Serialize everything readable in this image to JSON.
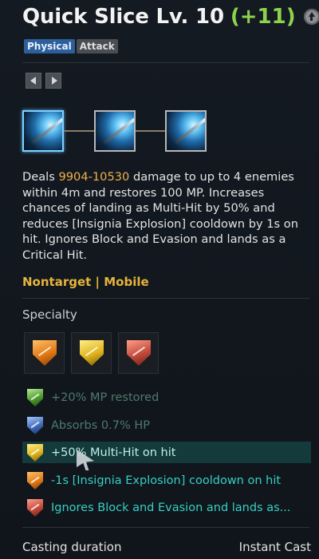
{
  "skill": {
    "name": "Quick Slice Lv. 10",
    "bonus": "(+11)",
    "tags": [
      "Physical",
      "Attack"
    ],
    "description": {
      "prefix": "Deals ",
      "damage": "9904-10530",
      "rest": " damage to up to 4 enemies within 4m and restores 100 MP. Increases chances of landing as Multi-Hit by 50% and reduces [Insignia Explosion] cooldown by 1s on hit. Ignores Block and Evasion and lands as a Critical Hit."
    },
    "properties": "Nontarget | Mobile"
  },
  "specialty": {
    "title": "Specialty",
    "slots": [
      {
        "icon": "specialty-orange-shield-icon",
        "color": "#e07a14"
      },
      {
        "icon": "specialty-yellow-shield-icon",
        "color": "#e0b41c"
      },
      {
        "icon": "specialty-red-shield-icon",
        "color": "#c24a3b"
      }
    ],
    "effects": [
      {
        "label": "+20% MP restored",
        "state": "inactive",
        "icon": "green-shield-icon",
        "color": "#4d9a2a"
      },
      {
        "label": "Absorbs 0.7% HP",
        "state": "inactive",
        "icon": "blue-shield-icon",
        "color": "#3f6ab8"
      },
      {
        "label": "+50% Multi-Hit on hit",
        "state": "hovered",
        "icon": "yellow-shield-icon",
        "color": "#e0b41c"
      },
      {
        "label": "-1s [Insignia Explosion] cooldown on hit",
        "state": "active",
        "icon": "orange-shield-icon",
        "color": "#e07a14"
      },
      {
        "label": "Ignores Block and Evasion and lands as...",
        "state": "active",
        "icon": "red-shield-icon",
        "color": "#c24a3b"
      }
    ]
  },
  "casting": {
    "label": "Casting duration",
    "value": "Instant Cast"
  },
  "colors": {
    "bonus": "#8ed14d",
    "highlight": "#f0b24a",
    "properties": "#e5b33b",
    "active_effect": "#36d0c4",
    "inactive_effect": "#4c7a6a"
  }
}
